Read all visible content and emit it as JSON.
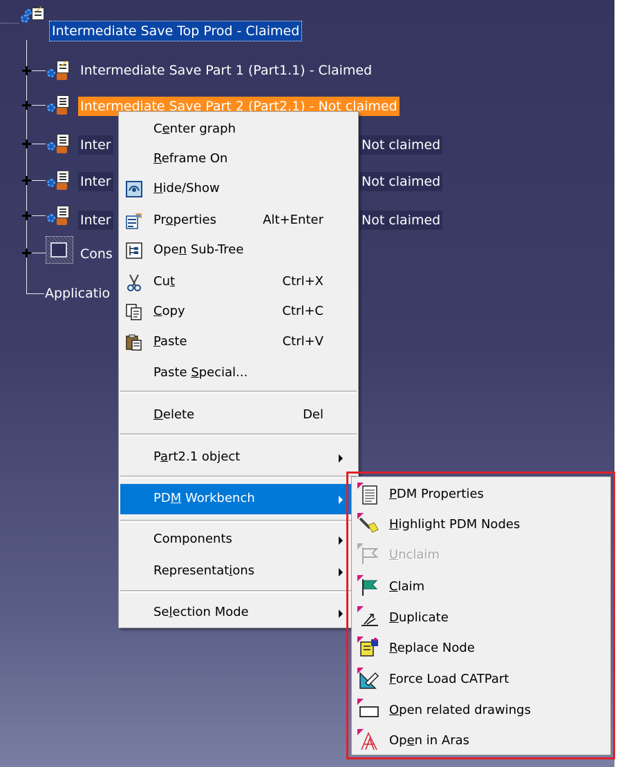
{
  "tree": {
    "root": "Intermediate Save Top Prod - Claimed",
    "nodes": [
      {
        "label": "Intermediate Save Part 1 (Part1.1) - Claimed"
      },
      {
        "label": "Intermediate Save Part 2 (Part2.1) - Not claimed"
      },
      {
        "prefix": "Inter",
        "suffix": "Not claimed"
      },
      {
        "prefix": "Inter",
        "suffix": "Not claimed"
      },
      {
        "prefix": "Inter",
        "suffix": "Not claimed"
      }
    ],
    "constraints_prefix": "Cons",
    "applications_prefix": "Applicatio"
  },
  "context_menu": {
    "items": [
      {
        "pre": "C",
        "u": "e",
        "post": "nter graph",
        "shortcut": ""
      },
      {
        "pre": "",
        "u": "R",
        "post": "eframe On",
        "shortcut": ""
      },
      {
        "pre": "",
        "u": "H",
        "post": "ide/Show",
        "shortcut": "",
        "icon": "hide-show-icon"
      },
      {
        "pre": "Pr",
        "u": "o",
        "post": "perties",
        "shortcut": "Alt+Enter",
        "icon": "properties-icon"
      },
      {
        "pre": "Ope",
        "u": "n",
        "post": " Sub-Tree",
        "shortcut": "",
        "icon": "subtree-icon"
      },
      {
        "pre": "Cu",
        "u": "t",
        "post": "",
        "shortcut": "Ctrl+X",
        "icon": "scissors-icon"
      },
      {
        "pre": "",
        "u": "C",
        "post": "opy",
        "shortcut": "Ctrl+C",
        "icon": "copy-icon"
      },
      {
        "pre": "",
        "u": "P",
        "post": "aste",
        "shortcut": "Ctrl+V",
        "icon": "paste-icon"
      },
      {
        "pre": "Paste ",
        "u": "S",
        "post": "pecial...",
        "shortcut": ""
      },
      {
        "pre": "",
        "u": "D",
        "post": "elete",
        "shortcut": "Del"
      },
      {
        "pre": "P",
        "u": "a",
        "post": "rt2.1 object",
        "shortcut": ""
      },
      {
        "pre": "PD",
        "u": "M",
        "post": " Workbench",
        "shortcut": ""
      },
      {
        "pre": "Components",
        "u": "",
        "post": "",
        "shortcut": ""
      },
      {
        "pre": "Representat",
        "u": "i",
        "post": "ons",
        "shortcut": ""
      },
      {
        "pre": "Se",
        "u": "l",
        "post": "ection Mode",
        "shortcut": ""
      }
    ]
  },
  "submenu": {
    "items": [
      {
        "pre": "",
        "u": "P",
        "post": "DM Properties",
        "icon": "pdm-properties-icon"
      },
      {
        "pre": "",
        "u": "H",
        "post": "ighlight PDM Nodes",
        "icon": "highlight-icon"
      },
      {
        "pre": "",
        "u": "U",
        "post": "nclaim",
        "icon": "unclaim-flag-icon",
        "disabled": true
      },
      {
        "pre": "",
        "u": "C",
        "post": "laim",
        "icon": "claim-flag-icon"
      },
      {
        "pre": "",
        "u": "D",
        "post": "uplicate",
        "icon": "duplicate-icon"
      },
      {
        "pre": "",
        "u": "R",
        "post": "eplace Node",
        "icon": "replace-node-icon"
      },
      {
        "pre": "",
        "u": "F",
        "post": "orce Load CATPart",
        "icon": "force-load-icon"
      },
      {
        "pre": "",
        "u": "O",
        "post": "pen related drawings",
        "icon": "drawing-icon"
      },
      {
        "pre": "Op",
        "u": "e",
        "post": "n in Aras",
        "icon": "aras-icon"
      }
    ]
  },
  "colors": {
    "selection_blue": "#0a46a6",
    "highlight_orange": "#ff8c1a",
    "menu_highlight": "#0078d7",
    "outline_red": "#e0202a"
  }
}
